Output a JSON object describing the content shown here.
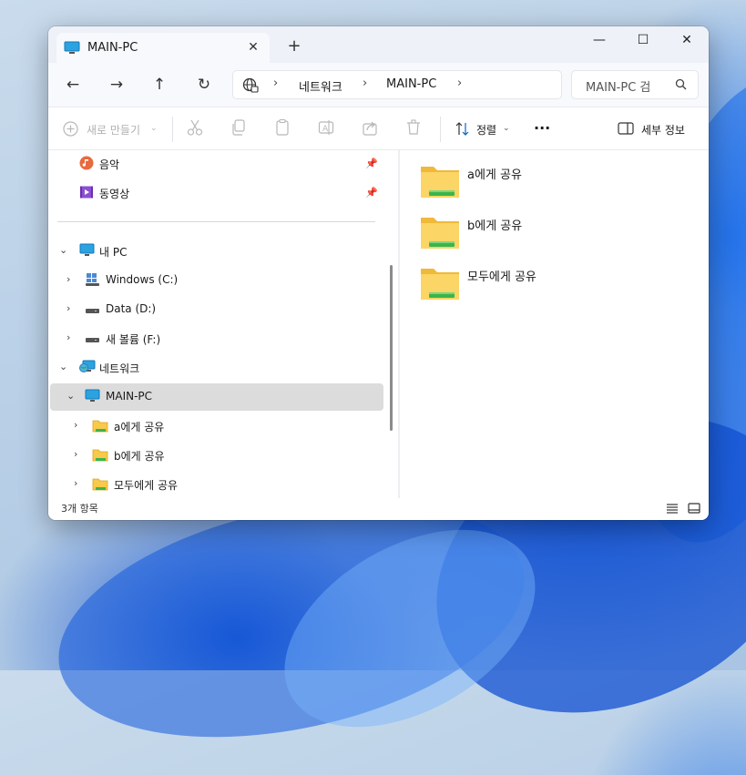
{
  "window": {
    "tab_title": "MAIN-PC",
    "new_tab": "+",
    "caption": {
      "minimize": "—",
      "maximize": "☐",
      "close": "✕"
    }
  },
  "nav": {
    "back": "←",
    "forward": "→",
    "up": "↑",
    "refresh": "↻",
    "breadcrumb": [
      "네트워크",
      "MAIN-PC"
    ],
    "search_placeholder": "MAIN-PC 검"
  },
  "toolbar": {
    "new_label": "새로 만들기",
    "sort_label": "정렬",
    "more": "···",
    "details_label": "세부 정보"
  },
  "sidebar": {
    "quick": [
      {
        "label": "음악"
      },
      {
        "label": "동영상"
      }
    ],
    "tree": [
      {
        "label": "내 PC"
      },
      {
        "label": "Windows (C:)"
      },
      {
        "label": "Data (D:)"
      },
      {
        "label": "새 볼륨 (F:)"
      },
      {
        "label": "네트워크"
      },
      {
        "label": "MAIN-PC"
      },
      {
        "label": "a에게 공유"
      },
      {
        "label": "b에게 공유"
      },
      {
        "label": "모두에게 공유"
      }
    ]
  },
  "content": {
    "items": [
      {
        "name": "a에게 공유"
      },
      {
        "name": "b에게 공유"
      },
      {
        "name": "모두에게 공유"
      }
    ]
  },
  "status": {
    "count": "3개 항목"
  },
  "colors": {
    "accent": "#0067c0",
    "folder": "#f8c94a",
    "share": "#3bb54a",
    "selection": "#dcdcdc"
  }
}
